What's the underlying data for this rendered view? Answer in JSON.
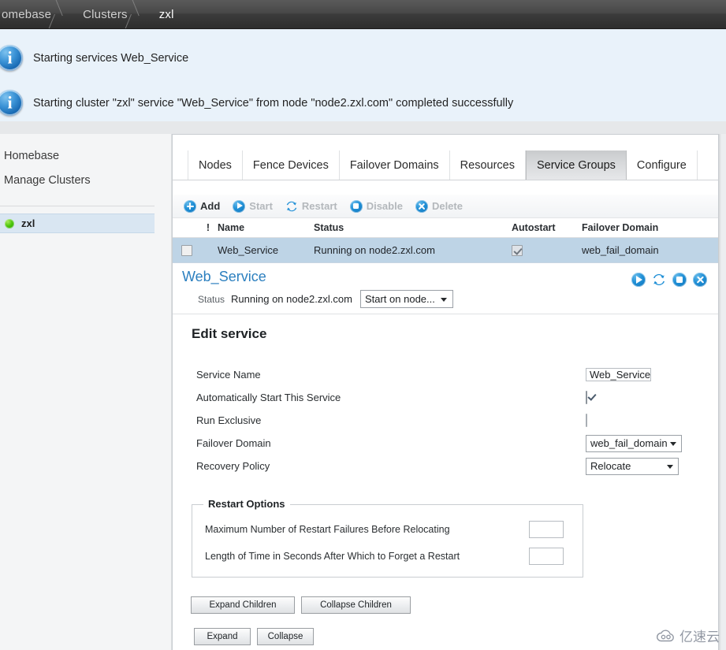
{
  "breadcrumb": {
    "items": [
      {
        "label": "omebase",
        "active": false
      },
      {
        "label": "Clusters",
        "active": false
      },
      {
        "label": "zxl",
        "active": true
      }
    ]
  },
  "messages": [
    {
      "icon": "info-icon",
      "text": "Starting services Web_Service"
    },
    {
      "icon": "info-icon",
      "text": "Starting cluster \"zxl\" service \"Web_Service\" from node \"node2.zxl.com\" completed successfully"
    }
  ],
  "sidebar": {
    "links": [
      {
        "label": "Homebase"
      },
      {
        "label": "Manage Clusters"
      }
    ],
    "cluster": {
      "label": "zxl",
      "status_color": "#4fc70d"
    }
  },
  "tabs": [
    {
      "label": "Nodes",
      "selected": false
    },
    {
      "label": "Fence Devices",
      "selected": false
    },
    {
      "label": "Failover Domains",
      "selected": false
    },
    {
      "label": "Resources",
      "selected": false
    },
    {
      "label": "Service Groups",
      "selected": true
    },
    {
      "label": "Configure",
      "selected": false
    }
  ],
  "toolbar": {
    "add": {
      "label": "Add",
      "icon": "plus-circle-icon",
      "enabled": true
    },
    "start": {
      "label": "Start",
      "icon": "play-circle-icon",
      "enabled": false
    },
    "restart": {
      "label": "Restart",
      "icon": "restart-arrows-icon",
      "enabled": false
    },
    "disable": {
      "label": "Disable",
      "icon": "stop-circle-icon",
      "enabled": false
    },
    "delete": {
      "label": "Delete",
      "icon": "close-circle-icon",
      "enabled": false
    }
  },
  "table": {
    "headers": {
      "alert": "!",
      "name": "Name",
      "status": "Status",
      "autostart": "Autostart",
      "failover_domain": "Failover Domain"
    },
    "rows": [
      {
        "selected": false,
        "name": "Web_Service",
        "status": "Running on node2.zxl.com",
        "autostart": true,
        "failover_domain": "web_fail_domain"
      }
    ]
  },
  "service_detail": {
    "title": "Web_Service",
    "status_label": "Status",
    "status_value": "Running on node2.zxl.com",
    "node_select_value": "Start on node...",
    "actions": [
      {
        "name": "start-service-icon",
        "icon": "play-circle-icon"
      },
      {
        "name": "restart-service-icon",
        "icon": "restart-arrows-icon"
      },
      {
        "name": "disable-service-icon",
        "icon": "stop-circle-icon"
      },
      {
        "name": "delete-service-icon",
        "icon": "close-circle-icon"
      }
    ],
    "accent_color": "#2b7fbf"
  },
  "edit_service": {
    "heading": "Edit service",
    "fields": [
      {
        "label": "Service Name",
        "type": "text",
        "value": "Web_Service"
      },
      {
        "label": "Automatically Start This Service",
        "type": "checkbox",
        "checked": true
      },
      {
        "label": "Run Exclusive",
        "type": "checkbox",
        "checked": false
      },
      {
        "label": "Failover Domain",
        "type": "select",
        "value": "web_fail_domain"
      },
      {
        "label": "Recovery Policy",
        "type": "select",
        "value": "Relocate"
      }
    ],
    "restart_options": {
      "legend": "Restart Options",
      "rows": [
        {
          "label": "Maximum Number of Restart Failures Before Relocating",
          "value": ""
        },
        {
          "label": "Length of Time in Seconds After Which to Forget a Restart",
          "value": ""
        }
      ]
    },
    "buttons_children": [
      {
        "label": "Expand Children"
      },
      {
        "label": "Collapse Children"
      }
    ],
    "buttons_tree": [
      {
        "label": "Expand"
      },
      {
        "label": "Collapse"
      }
    ]
  },
  "watermark": {
    "text": "亿速云",
    "icon": "cloud-icon"
  }
}
